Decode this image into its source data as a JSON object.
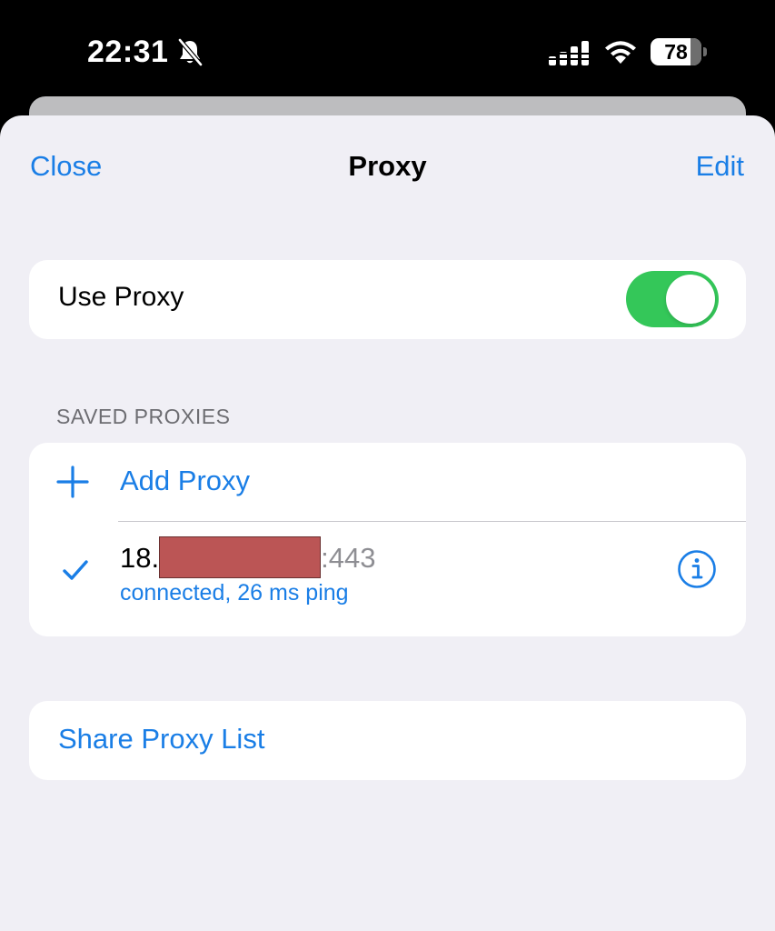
{
  "status_bar": {
    "time": "22:31",
    "battery_level": "78",
    "battery_fraction": 0.78,
    "icons": [
      "bell-slash-icon",
      "cellular-signal-icon",
      "wifi-icon",
      "battery-icon"
    ]
  },
  "nav": {
    "close_label": "Close",
    "title": "Proxy",
    "edit_label": "Edit"
  },
  "use_proxy": {
    "label": "Use Proxy",
    "enabled": true
  },
  "saved_proxies": {
    "header": "SAVED PROXIES",
    "add_label": "Add Proxy",
    "items": [
      {
        "address_prefix": "18.",
        "address_port": ":443",
        "status": "connected, 26 ms ping",
        "selected": true
      }
    ]
  },
  "share": {
    "label": "Share Proxy List"
  },
  "colors": {
    "accent": "#1a7ee6",
    "toggle_on": "#34c759",
    "background": "#f0eff5",
    "redaction": "#bb5555"
  }
}
